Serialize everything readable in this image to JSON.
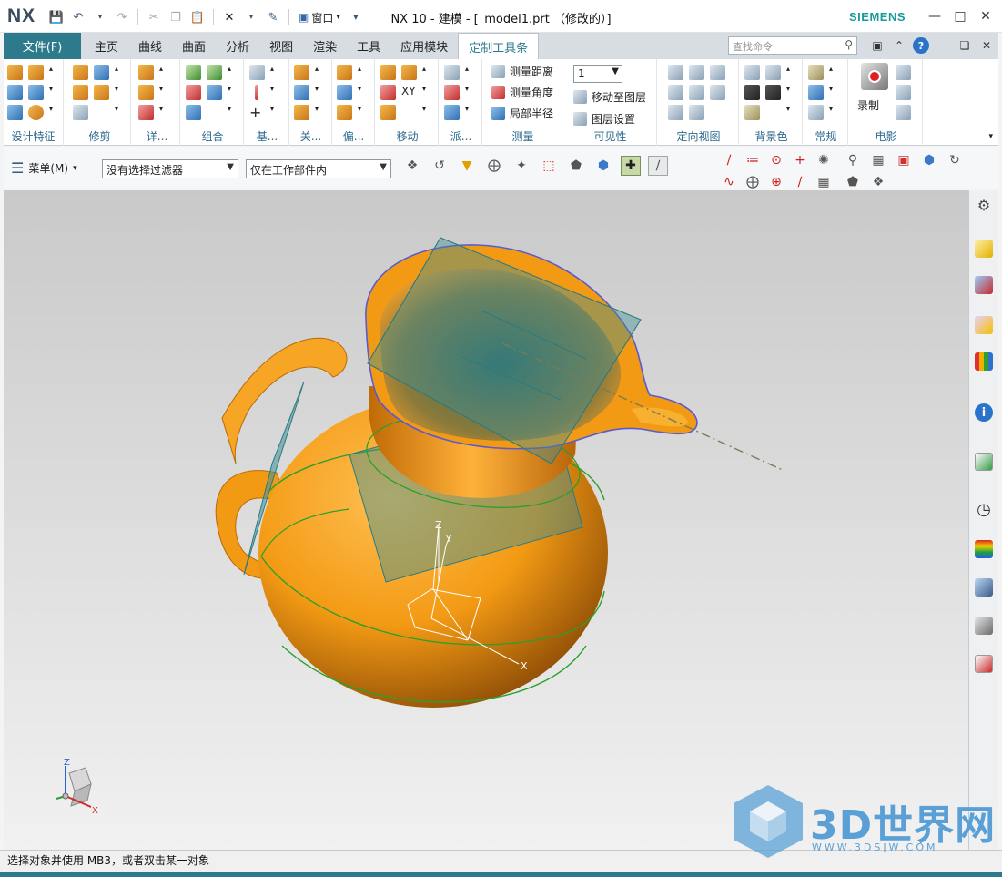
{
  "app": {
    "logo": "NX",
    "window_menu_label": "窗口",
    "title": "NX 10 - 建模 - [_model1.prt （修改的）]",
    "brand": "SIEMENS"
  },
  "ribbon_tabs": {
    "file": "文件(F)",
    "tabs": [
      "主页",
      "曲线",
      "曲面",
      "分析",
      "视图",
      "渲染",
      "工具",
      "应用模块",
      "定制工具条"
    ],
    "active_index": 8,
    "search_placeholder": "查找命令"
  },
  "ribbon_groups": {
    "design_feature": "设计特征",
    "trim": "修剪",
    "detail": "详...",
    "combine": "组合",
    "base": "基...",
    "assoc": "关...",
    "offset": "偏...",
    "move": "移动",
    "derive": "派...",
    "measure": "测量",
    "visibility": "可见性",
    "orient_view": "定向视图",
    "background": "背景色",
    "general": "常规",
    "movie": "电影"
  },
  "measure_items": [
    "测量距离",
    "测量角度",
    "局部半径"
  ],
  "visibility": {
    "layer_value": "1",
    "move_to_layer": "移动至图层",
    "layer_settings": "图层设置"
  },
  "movie": {
    "record_label": "录制"
  },
  "selection_bar": {
    "menu_label": "菜单(M)",
    "filter_value": "没有选择过滤器",
    "scope_value": "仅在工作部件内"
  },
  "viewport": {
    "axis_labels": {
      "x": "X",
      "y": "Y",
      "z": "Z"
    }
  },
  "status_bar": {
    "message": "选择对象并使用 MB3，或者双击某一对象"
  },
  "watermark": {
    "text": "3D世界网",
    "url": "WWW.3DSJW.COM"
  },
  "colors": {
    "accent": "#2c7a8c",
    "model_orange": "#f39a14",
    "plane_teal": "#3f8f95",
    "edge_green": "#2aa02a",
    "brand": "#1a9a9a"
  },
  "icons": {
    "save": "save-icon",
    "undo": "undo-icon",
    "redo": "redo-icon",
    "search": "search-icon",
    "help": "help-icon",
    "settings": "gear-icon"
  }
}
